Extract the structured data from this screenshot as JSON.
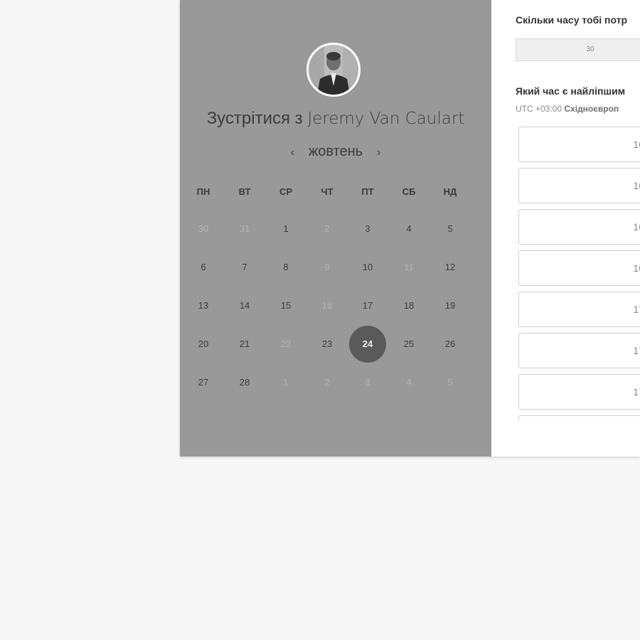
{
  "host": {
    "prefix": "Зустрітися з",
    "name": "Jeremy Van Caulart"
  },
  "calendar": {
    "prev_icon": "‹",
    "next_icon": "›",
    "month": "жовтень",
    "weekdays": [
      "ПН",
      "ВТ",
      "СР",
      "ЧТ",
      "ПТ",
      "СБ",
      "НД"
    ],
    "weeks": [
      [
        {
          "d": "30",
          "muted": true
        },
        {
          "d": "31",
          "muted": true
        },
        {
          "d": "1"
        },
        {
          "d": "2",
          "muted": true
        },
        {
          "d": "3"
        },
        {
          "d": "4"
        },
        {
          "d": "5"
        }
      ],
      [
        {
          "d": "6"
        },
        {
          "d": "7"
        },
        {
          "d": "8"
        },
        {
          "d": "9",
          "muted": true
        },
        {
          "d": "10"
        },
        {
          "d": "11",
          "muted": true
        },
        {
          "d": "12"
        }
      ],
      [
        {
          "d": "13"
        },
        {
          "d": "14"
        },
        {
          "d": "15"
        },
        {
          "d": "16",
          "muted": true
        },
        {
          "d": "17"
        },
        {
          "d": "18"
        },
        {
          "d": "19"
        }
      ],
      [
        {
          "d": "20"
        },
        {
          "d": "21"
        },
        {
          "d": "22",
          "muted": true
        },
        {
          "d": "23"
        },
        {
          "d": "24",
          "selected": true
        },
        {
          "d": "25"
        },
        {
          "d": "26"
        }
      ],
      [
        {
          "d": "27"
        },
        {
          "d": "28"
        },
        {
          "d": "1",
          "muted": true
        },
        {
          "d": "2",
          "muted": true
        },
        {
          "d": "3",
          "muted": true
        },
        {
          "d": "4",
          "muted": true
        },
        {
          "d": "5",
          "muted": true
        }
      ]
    ]
  },
  "booking": {
    "duration_question": "Скільки часу тобі потр",
    "duration_value": "30",
    "time_question": "Який час є найліпшим",
    "timezone_prefix": "UTC +03:00",
    "timezone_name": "Східноєвроп",
    "slots": [
      "16",
      "16",
      "16",
      "16",
      "17",
      "17",
      "17"
    ]
  },
  "colors": {
    "left_panel": "#999999",
    "selected_day": "#5a5a5a",
    "page_background": "#f7f7f7"
  }
}
